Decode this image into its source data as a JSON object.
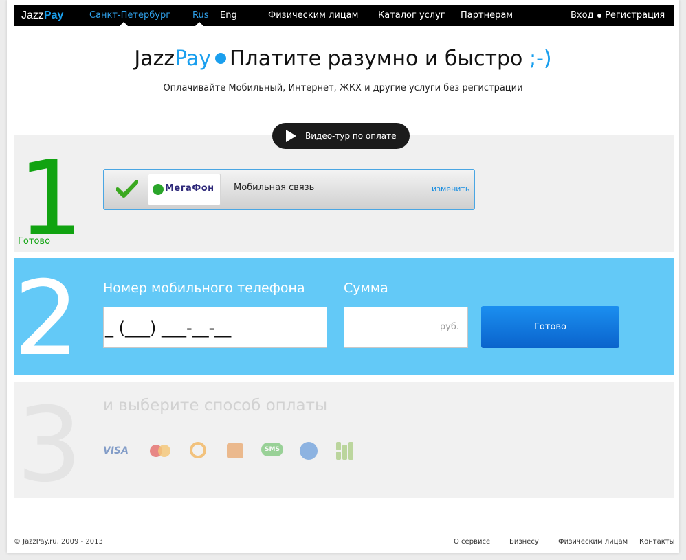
{
  "nav": {
    "logo_jazz": "Jazz",
    "logo_pay": "Pay",
    "city": "Санкт-Петербург",
    "lang_rus": "Rus",
    "lang_eng": "Eng",
    "individuals": "Физическим лицам",
    "catalog": "Каталог услуг",
    "partners": "Партнерам",
    "login": "Вход",
    "register": "Регистрация"
  },
  "hero": {
    "title_jazz": "Jazz",
    "title_pay": "Pay",
    "title_text": "Платите разумно и быстро",
    "title_smile": ";-)",
    "subtitle": "Оплачивайте Мобильный, Интернет, ЖКХ и другие услуги без регистрации"
  },
  "video_button": {
    "label": "Видео-тур по оплате"
  },
  "step1": {
    "number": "1",
    "status": "Готово",
    "operator_logo_text": "МегаФон",
    "service_name": "Мобильная связь",
    "change_link": "изменить",
    "colors": {
      "accent": "#11a311"
    }
  },
  "step2": {
    "number": "2",
    "phone_label": "Номер мобильного телефона",
    "phone_value": "_ (___) ___-__-__",
    "sum_label": "Сумма",
    "sum_value": "",
    "currency": "руб.",
    "submit_label": "Готово",
    "colors": {
      "background": "#63c9f7",
      "button": "#1b8ff0"
    }
  },
  "step3": {
    "number": "3",
    "title": "и выберите способ оплаты",
    "methods": [
      {
        "icon": "visa-icon",
        "text": "VISA"
      },
      {
        "icon": "mastercard-icon",
        "text": ""
      },
      {
        "icon": "qiwi-icon",
        "text": ""
      },
      {
        "icon": "wallet-icon",
        "text": ""
      },
      {
        "icon": "sms-icon",
        "text": "SMS"
      },
      {
        "icon": "webmoney-icon",
        "text": ""
      },
      {
        "icon": "other-payment-icon",
        "text": ""
      }
    ]
  },
  "footer": {
    "copyright": "© JazzPay.ru, 2009 - 2013",
    "about": "О сервисе",
    "business": "Бизнесу",
    "individuals": "Физическим лицам",
    "contacts": "Контакты"
  }
}
